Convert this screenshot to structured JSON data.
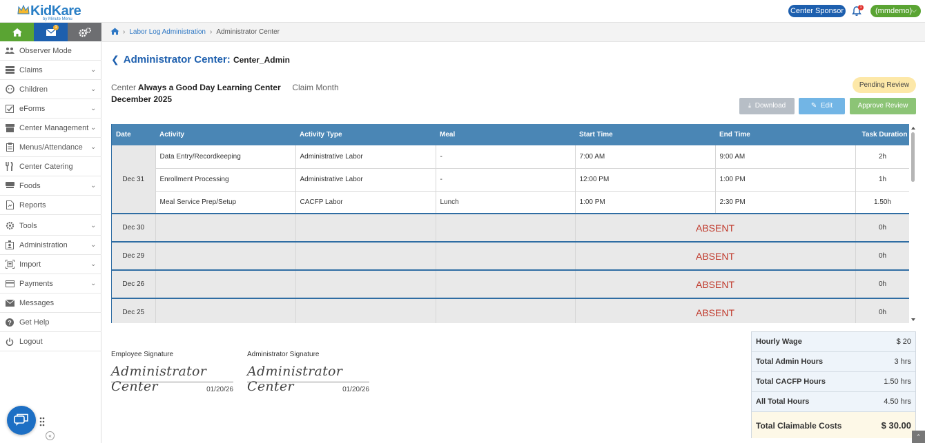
{
  "header": {
    "logo": "KidKare",
    "logo_tagline": "by Minute Menu",
    "sponsor_button": "Center Sponsor",
    "notification_count": "1",
    "user_menu": "(mmdemo)"
  },
  "sidebar": {
    "mail_badge": "1",
    "items": [
      {
        "label": "Observer Mode",
        "icon": "people-icon",
        "expandable": false
      },
      {
        "label": "Claims",
        "icon": "claims-icon",
        "expandable": true
      },
      {
        "label": "Children",
        "icon": "child-face-icon",
        "expandable": true
      },
      {
        "label": "eForms",
        "icon": "checkbox-icon",
        "expandable": true
      },
      {
        "label": "Center Management",
        "icon": "building-icon",
        "expandable": true
      },
      {
        "label": "Menus/Attendance",
        "icon": "clipboard-icon",
        "expandable": true
      },
      {
        "label": "Center Catering",
        "icon": "utensils-icon",
        "expandable": false
      },
      {
        "label": "Foods",
        "icon": "food-icon",
        "expandable": true
      },
      {
        "label": "Reports",
        "icon": "report-icon",
        "expandable": false
      },
      {
        "label": "Tools",
        "icon": "tools-gear-icon",
        "expandable": true
      },
      {
        "label": "Administration",
        "icon": "admin-icon",
        "expandable": true
      },
      {
        "label": "Import",
        "icon": "import-icon",
        "expandable": true
      },
      {
        "label": "Payments",
        "icon": "credit-card-icon",
        "expandable": true
      },
      {
        "label": "Messages",
        "icon": "envelope-icon",
        "expandable": false
      },
      {
        "label": "Get Help",
        "icon": "help-icon",
        "expandable": false
      },
      {
        "label": "Logout",
        "icon": "power-icon",
        "expandable": false
      }
    ]
  },
  "breadcrumb": {
    "link": "Labor Log Administration",
    "current": "Administrator Center"
  },
  "page": {
    "title": "Administrator Center:",
    "subtitle": "Center_Admin",
    "center_label": "Center",
    "center_value": "Always a Good Day Learning Center",
    "claim_month_label": "Claim Month",
    "claim_month_value": "December 2025",
    "status_badge": "Pending Review",
    "download_label": "Download",
    "edit_label": "Edit",
    "approve_label": "Approve Review"
  },
  "table": {
    "columns": [
      "Date",
      "Activity",
      "Activity Type",
      "Meal",
      "Start Time",
      "End Time",
      "Task Duration"
    ],
    "dec31": {
      "date": "Dec 31",
      "rows": [
        {
          "activity": "Data Entry/Recordkeeping",
          "type": "Administrative Labor",
          "meal": "-",
          "start": "7:00 AM",
          "end": "9:00 AM",
          "duration": "2h"
        },
        {
          "activity": "Enrollment Processing",
          "type": "Administrative Labor",
          "meal": "-",
          "start": "12:00 PM",
          "end": "1:00 PM",
          "duration": "1h"
        },
        {
          "activity": "Meal Service Prep/Setup",
          "type": "CACFP Labor",
          "meal": "Lunch",
          "start": "1:00 PM",
          "end": "2:30 PM",
          "duration": "1.50h"
        }
      ]
    },
    "absent_rows": [
      {
        "date": "Dec 30",
        "status": "ABSENT",
        "duration": "0h"
      },
      {
        "date": "Dec 29",
        "status": "ABSENT",
        "duration": "0h"
      },
      {
        "date": "Dec 26",
        "status": "ABSENT",
        "duration": "0h"
      },
      {
        "date": "Dec 25",
        "status": "ABSENT",
        "duration": "0h"
      }
    ]
  },
  "signatures": {
    "employee": {
      "label": "Employee Signature",
      "signature": "Administrator Center",
      "date": "01/20/26"
    },
    "administrator": {
      "label": "Administrator Signature",
      "signature": "Administrator Center",
      "date": "01/20/26"
    }
  },
  "summary": {
    "hourly_wage_label": "Hourly Wage",
    "hourly_wage": "$ 20",
    "admin_hours_label": "Total Admin Hours",
    "admin_hours": "3 hrs",
    "cacfp_hours_label": "Total CACFP Hours",
    "cacfp_hours": "1.50 hrs",
    "all_hours_label": "All Total Hours",
    "all_hours": "4.50 hrs",
    "claimable_label": "Total Claimable Costs",
    "claimable": "$ 30.00"
  },
  "colors": {
    "brand_blue": "#1d5fae",
    "brand_green": "#5aa433",
    "table_header": "#4a86b5",
    "absent_red": "#c0392b"
  }
}
